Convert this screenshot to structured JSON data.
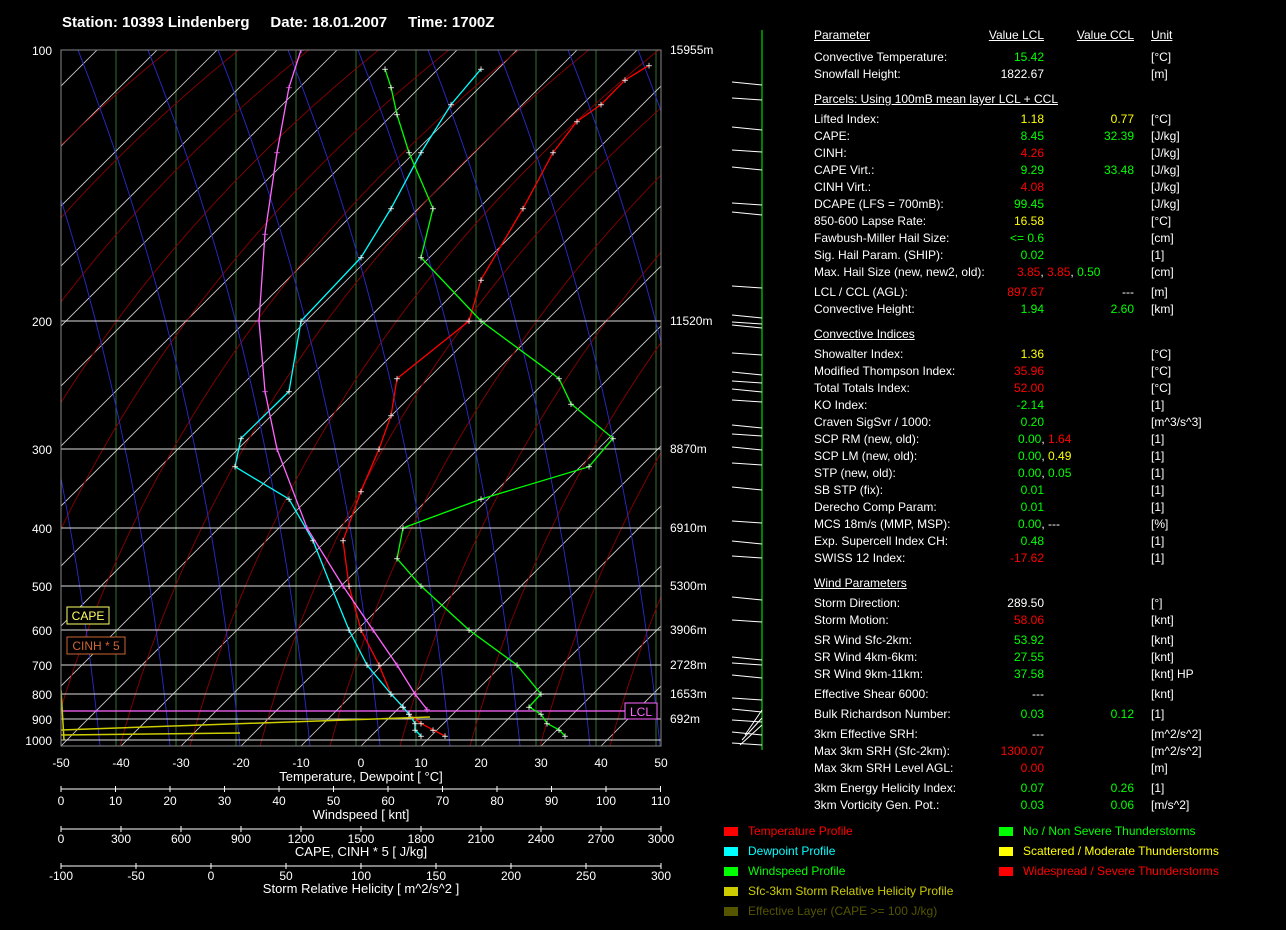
{
  "header": {
    "station": "Station: 10393 Lindenberg",
    "date": "Date: 18.01.2007",
    "time": "Time: 1700Z"
  },
  "colors": {
    "temperature": "#ff0000",
    "dewpoint": "#00ffff",
    "windspeed": "#00ff00",
    "srh": "#cccc00",
    "parcel": "#ff66ff",
    "effective_layer": "#555500",
    "cape_box": "#ffff66",
    "cinh_box": "#cc6633"
  },
  "chart_data": {
    "type": "line",
    "diagram": "Skew-T log-P",
    "xlabel": "Temperature, Dewpoint  [ °C]",
    "xlim": [
      -50,
      50
    ],
    "temperature_ticks": [
      "-50",
      "-40",
      "-30",
      "-20",
      "-10",
      "0",
      "10",
      "20",
      "30",
      "40",
      "50"
    ],
    "pressure_ticks": [
      "100",
      "200",
      "300",
      "400",
      "500",
      "600",
      "700",
      "800",
      "900",
      "1000"
    ],
    "height_labels": [
      {
        "p": 100,
        "label": "15955m"
      },
      {
        "p": 200,
        "label": "11520m"
      },
      {
        "p": 300,
        "label": "8870m"
      },
      {
        "p": 400,
        "label": "6910m"
      },
      {
        "p": 500,
        "label": "5300m"
      },
      {
        "p": 600,
        "label": "3906m"
      },
      {
        "p": 700,
        "label": "2728m"
      },
      {
        "p": 800,
        "label": "1653m"
      },
      {
        "p": 900,
        "label": "692m"
      }
    ],
    "windspeed_axis": {
      "label": "Windspeed  [ knt]",
      "ticks": [
        "0",
        "10",
        "20",
        "30",
        "40",
        "50",
        "60",
        "70",
        "80",
        "90",
        "100",
        "110"
      ]
    },
    "cape_axis": {
      "label": "CAPE, CINH * 5  [ J/kg]",
      "ticks": [
        "0",
        "300",
        "600",
        "900",
        "1200",
        "1500",
        "1800",
        "2100",
        "2400",
        "2700",
        "3000"
      ]
    },
    "srh_axis": {
      "label": "Storm Relative Helicity  [ m^2/s^2 ]",
      "ticks": [
        "-100",
        "-50",
        "0",
        "50",
        "100",
        "150",
        "200",
        "250",
        "300"
      ]
    },
    "series": [
      {
        "name": "Temperature Profile",
        "color": "#ff0000",
        "points": [
          [
            14,
            980
          ],
          [
            12,
            950
          ],
          [
            10,
            920
          ],
          [
            8,
            880
          ],
          [
            7,
            850
          ],
          [
            5,
            800
          ],
          [
            3,
            700
          ],
          [
            0,
            600
          ],
          [
            -2,
            500
          ],
          [
            -3,
            420
          ],
          [
            0,
            350
          ],
          [
            3,
            300
          ],
          [
            5,
            270
          ],
          [
            6,
            240
          ],
          [
            18,
            200
          ],
          [
            20,
            180
          ],
          [
            27,
            150
          ],
          [
            32,
            130
          ],
          [
            36,
            120
          ],
          [
            40,
            115
          ],
          [
            44,
            108
          ],
          [
            48,
            104
          ]
        ]
      },
      {
        "name": "Dewpoint Profile",
        "color": "#00ffff",
        "points": [
          [
            10,
            980
          ],
          [
            9,
            950
          ],
          [
            9,
            920
          ],
          [
            8,
            880
          ],
          [
            7,
            850
          ],
          [
            5,
            800
          ],
          [
            1,
            700
          ],
          [
            -2,
            600
          ],
          [
            -5,
            500
          ],
          [
            -8,
            420
          ],
          [
            -12,
            360
          ],
          [
            -21,
            320
          ],
          [
            -20,
            290
          ],
          [
            -12,
            250
          ],
          [
            -10,
            200
          ],
          [
            0,
            170
          ],
          [
            5,
            150
          ],
          [
            10,
            130
          ],
          [
            15,
            115
          ],
          [
            20,
            105
          ]
        ]
      },
      {
        "name": "Windspeed Profile",
        "color": "#00ff00",
        "points": [
          [
            34,
            980
          ],
          [
            33,
            950
          ],
          [
            31,
            920
          ],
          [
            30,
            880
          ],
          [
            28,
            850
          ],
          [
            30,
            800
          ],
          [
            26,
            700
          ],
          [
            18,
            600
          ],
          [
            10,
            500
          ],
          [
            6,
            450
          ],
          [
            7,
            400
          ],
          [
            20,
            360
          ],
          [
            38,
            320
          ],
          [
            42,
            290
          ],
          [
            35,
            260
          ],
          [
            33,
            240
          ],
          [
            20,
            200
          ],
          [
            10,
            170
          ],
          [
            12,
            150
          ],
          [
            8,
            130
          ],
          [
            6,
            118
          ],
          [
            5,
            110
          ],
          [
            4,
            105
          ]
        ]
      },
      {
        "name": "Lifted Parcel",
        "color": "#ff66ff",
        "points": [
          [
            11,
            860
          ],
          [
            9,
            800
          ],
          [
            6,
            700
          ],
          [
            2,
            600
          ],
          [
            -3,
            500
          ],
          [
            -9,
            400
          ],
          [
            -14,
            300
          ],
          [
            -16,
            250
          ],
          [
            -17,
            200
          ],
          [
            -16,
            160
          ],
          [
            -14,
            130
          ],
          [
            -12,
            110
          ],
          [
            -10,
            100
          ]
        ]
      }
    ],
    "boxes": [
      {
        "label": "CAPE",
        "color": "#ffff66"
      },
      {
        "label": "CINH * 5",
        "color": "#cc6633"
      },
      {
        "label": "LCL",
        "color": "#ff66ff"
      }
    ]
  },
  "table": {
    "head": {
      "param": "Parameter",
      "lcl": "Value LCL",
      "ccl": "Value CCL",
      "unit": "Unit"
    },
    "rows": [
      {
        "y": 57,
        "name": "Convective Temperature:",
        "v1": "15.42",
        "c1": "g",
        "v2": "",
        "c2": "w",
        "unit": "[°C]"
      },
      {
        "y": 74,
        "name": "Snowfall Height:",
        "v1": "1822.67",
        "c1": "w",
        "v2": "",
        "c2": "w",
        "unit": "[m]"
      },
      {
        "y": 99,
        "name": "Parcels: Using 100mB mean layer LCL + CCL",
        "section": true
      },
      {
        "y": 119,
        "name": "Lifted Index:",
        "v1": "1.18",
        "c1": "y",
        "v2": "0.77",
        "c2": "y",
        "unit": "[°C]"
      },
      {
        "y": 136,
        "name": "CAPE:",
        "v1": "8.45",
        "c1": "g",
        "v2": "32.39",
        "c2": "g",
        "unit": "[J/kg]"
      },
      {
        "y": 153,
        "name": "CINH:",
        "v1": "4.26",
        "c1": "r",
        "v2": "",
        "c2": "w",
        "unit": "[J/kg]"
      },
      {
        "y": 170,
        "name": "CAPE Virt.:",
        "v1": "9.29",
        "c1": "g",
        "v2": "33.48",
        "c2": "g",
        "unit": "[J/kg]"
      },
      {
        "y": 187,
        "name": "CINH Virt.:",
        "v1": "4.08",
        "c1": "r",
        "v2": "",
        "c2": "w",
        "unit": "[J/kg]"
      },
      {
        "y": 204,
        "name": "DCAPE (LFS = 700mB):",
        "v1": "99.45",
        "c1": "g",
        "v2": "",
        "c2": "w",
        "unit": "[J/kg]"
      },
      {
        "y": 221,
        "name": "850-600 Lapse Rate:",
        "v1": "16.58",
        "c1": "y",
        "v2": "",
        "c2": "w",
        "unit": "[°C]"
      },
      {
        "y": 238,
        "name": "Fawbush-Miller Hail Size:",
        "v1": "<= 0.6",
        "c1": "g",
        "v2": "",
        "c2": "w",
        "unit": "[cm]"
      },
      {
        "y": 255,
        "name": "Sig. Hail Param. (SHIP):",
        "v1": "0.02",
        "c1": "g",
        "v2": "",
        "c2": "w",
        "unit": "[1]"
      },
      {
        "y": 292,
        "name": "LCL / CCL (AGL):",
        "v1": "897.67",
        "c1": "r",
        "v2": "---",
        "c2": "w",
        "unit": "[m]"
      },
      {
        "y": 309,
        "name": "Convective Height:",
        "v1": "1.94",
        "c1": "g",
        "v2": "2.60",
        "c2": "g",
        "unit": "[km]"
      },
      {
        "y": 334,
        "name": "Convective Indices",
        "section": true
      },
      {
        "y": 354,
        "name": "Showalter Index:",
        "v1": "1.36",
        "c1": "y",
        "v2": "",
        "c2": "w",
        "unit": "[°C]"
      },
      {
        "y": 371,
        "name": "Modified Thompson Index:",
        "v1": "35.96",
        "c1": "r",
        "v2": "",
        "c2": "w",
        "unit": "[°C]"
      },
      {
        "y": 388,
        "name": "Total Totals Index:",
        "v1": "52.00",
        "c1": "r",
        "v2": "",
        "c2": "w",
        "unit": "[°C]"
      },
      {
        "y": 405,
        "name": "KO Index:",
        "v1": "-2.14",
        "c1": "g",
        "v2": "",
        "c2": "w",
        "unit": "[1]"
      },
      {
        "y": 422,
        "name": "Craven SigSvr / 1000:",
        "v1": "0.20",
        "c1": "g",
        "v2": "",
        "c2": "w",
        "unit": "[m^3/s^3]"
      },
      {
        "y": 490,
        "name": "SB STP (fix):",
        "v1": "0.01",
        "c1": "g",
        "v2": "",
        "c2": "w",
        "unit": "[1]"
      },
      {
        "y": 507,
        "name": "Derecho Comp Param:",
        "v1": "0.01",
        "c1": "g",
        "v2": "",
        "c2": "w",
        "unit": "[1]"
      },
      {
        "y": 541,
        "name": "Exp. Supercell Index CH:",
        "v1": "0.48",
        "c1": "g",
        "v2": "",
        "c2": "w",
        "unit": "[1]"
      },
      {
        "y": 558,
        "name": "SWISS 12 Index:",
        "v1": "-17.62",
        "c1": "r",
        "v2": "",
        "c2": "w",
        "unit": "[1]"
      },
      {
        "y": 583,
        "name": "Wind Parameters",
        "section": true
      },
      {
        "y": 603,
        "name": "Storm Direction:",
        "v1": "289.50",
        "c1": "w",
        "v2": "",
        "c2": "w",
        "unit": "[°]"
      },
      {
        "y": 620,
        "name": "Storm Motion:",
        "v1": "58.06",
        "c1": "r",
        "v2": "",
        "c2": "w",
        "unit": "[knt]"
      },
      {
        "y": 640,
        "name": "SR Wind Sfc-2km:",
        "v1": "53.92",
        "c1": "g",
        "v2": "",
        "c2": "w",
        "unit": "[knt]"
      },
      {
        "y": 657,
        "name": "SR Wind 4km-6km:",
        "v1": "27.55",
        "c1": "g",
        "v2": "",
        "c2": "w",
        "unit": "[knt]"
      },
      {
        "y": 674,
        "name": "SR Wind 9km-11km:",
        "v1": "37.58",
        "c1": "g",
        "v2": "",
        "c2": "w",
        "unit": "[knt] HP"
      },
      {
        "y": 694,
        "name": "Effective Shear 6000:",
        "v1": "---",
        "c1": "w",
        "v2": "",
        "c2": "w",
        "unit": "[knt]"
      },
      {
        "y": 714,
        "name": "Bulk Richardson Number:",
        "v1": "0.03",
        "c1": "g",
        "v2": "0.12",
        "c2": "g",
        "unit": "[1]"
      },
      {
        "y": 734,
        "name": "3km Effective SRH:",
        "v1": "---",
        "c1": "w",
        "v2": "",
        "c2": "w",
        "unit": "[m^2/s^2]"
      },
      {
        "y": 751,
        "name": "Max 3km SRH (Sfc-2km):",
        "v1": "1300.07",
        "c1": "r",
        "v2": "",
        "c2": "w",
        "unit": "[m^2/s^2]"
      },
      {
        "y": 768,
        "name": "Max 3km SRH Level AGL:",
        "v1": "0.00",
        "c1": "r",
        "v2": "",
        "c2": "w",
        "unit": "[m]"
      },
      {
        "y": 788,
        "name": "3km Energy Helicity Index:",
        "v1": "0.07",
        "c1": "g",
        "v2": "0.26",
        "c2": "g",
        "unit": "[1]"
      },
      {
        "y": 805,
        "name": "3km Vorticity Gen. Pot.:",
        "v1": "0.03",
        "c1": "g",
        "v2": "0.06",
        "c2": "g",
        "unit": "[m/s^2]"
      }
    ],
    "pairs": [
      {
        "y": 272,
        "name": "Max. Hail Size (new, new2, old):",
        "parts": [
          {
            "t": "3.85",
            "c": "r"
          },
          {
            "t": ", ",
            "c": "w"
          },
          {
            "t": "3.85",
            "c": "r"
          },
          {
            "t": ",  ",
            "c": "w"
          },
          {
            "t": "0.50",
            "c": "g"
          }
        ],
        "unit": "[cm]"
      },
      {
        "y": 439,
        "name": "SCP RM (new, old):",
        "parts": [
          {
            "t": "0.00",
            "c": "g"
          },
          {
            "t": ",  ",
            "c": "w"
          },
          {
            "t": "1.64",
            "c": "r"
          }
        ],
        "unit": "[1]"
      },
      {
        "y": 456,
        "name": "SCP LM (new, old):",
        "parts": [
          {
            "t": "0.00",
            "c": "g"
          },
          {
            "t": ",  ",
            "c": "w"
          },
          {
            "t": "0.49",
            "c": "y"
          }
        ],
        "unit": "[1]"
      },
      {
        "y": 473,
        "name": "STP (new, old):",
        "parts": [
          {
            "t": "0.00",
            "c": "g"
          },
          {
            "t": ",  ",
            "c": "w"
          },
          {
            "t": "0.05",
            "c": "g"
          }
        ],
        "unit": "[1]"
      },
      {
        "y": 524,
        "name": "MCS 18m/s (MMP, MSP):",
        "parts": [
          {
            "t": "0.00",
            "c": "g"
          },
          {
            "t": ",  ---",
            "c": "w"
          }
        ],
        "unit": "[%]"
      }
    ]
  },
  "legend": [
    {
      "label": "Temperature Profile",
      "color": "#ff0000"
    },
    {
      "label": "Dewpoint Profile",
      "color": "#00ffff"
    },
    {
      "label": "Windspeed Profile",
      "color": "#00ff00"
    },
    {
      "label": "Sfc-3km Storm Relative Helicity Profile",
      "color": "#cccc00"
    },
    {
      "label": "Effective Layer (CAPE >= 100 J/kg)",
      "color": "#555500"
    },
    {
      "label": "No / Non Severe Thunderstorms",
      "color": "#00ff00"
    },
    {
      "label": "Scattered / Moderate Thunderstorms",
      "color": "#ffff00"
    },
    {
      "label": "Widespread / Severe Thunderstorms",
      "color": "#ff0000"
    }
  ]
}
